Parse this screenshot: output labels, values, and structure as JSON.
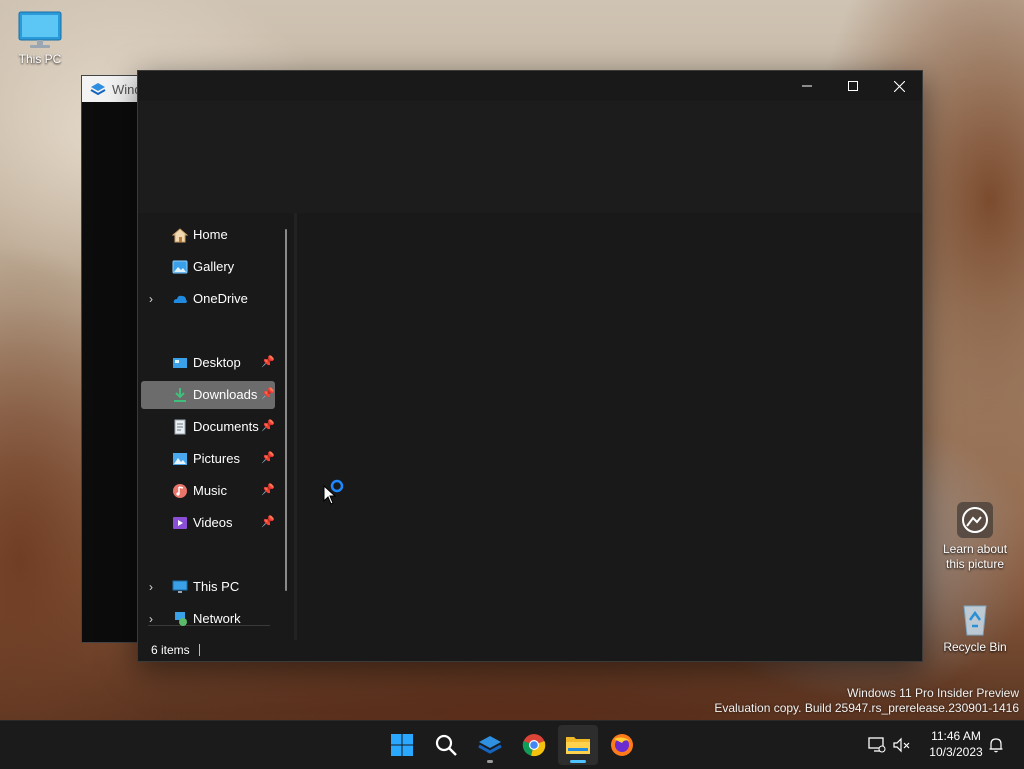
{
  "desktop": {
    "this_pc_label": "This PC",
    "learn_label_1": "Learn about",
    "learn_label_2": "this picture",
    "recycle_label": "Recycle Bin"
  },
  "background_window": {
    "title": "Wind"
  },
  "explorer": {
    "caption": {
      "minimize": "minimize-icon",
      "maximize": "maximize-icon",
      "close": "close-icon"
    },
    "nav": {
      "quick": [
        {
          "label": "Home",
          "icon": "home-icon"
        },
        {
          "label": "Gallery",
          "icon": "gallery-icon"
        },
        {
          "label": "OneDrive",
          "icon": "onedrive-icon",
          "expandable": true
        }
      ],
      "pinned": [
        {
          "label": "Desktop",
          "icon": "desktop-folder-icon"
        },
        {
          "label": "Downloads",
          "icon": "downloads-folder-icon",
          "selected": true
        },
        {
          "label": "Documents",
          "icon": "documents-folder-icon"
        },
        {
          "label": "Pictures",
          "icon": "pictures-folder-icon"
        },
        {
          "label": "Music",
          "icon": "music-folder-icon"
        },
        {
          "label": "Videos",
          "icon": "videos-folder-icon"
        }
      ],
      "devices": [
        {
          "label": "This PC",
          "icon": "this-pc-icon",
          "expandable": true
        },
        {
          "label": "Network",
          "icon": "network-icon",
          "expandable": true
        }
      ]
    },
    "status": {
      "items_count": "6 items"
    }
  },
  "taskbar": {
    "apps": [
      {
        "name": "start-button",
        "icon": "windows-logo-icon"
      },
      {
        "name": "search-button",
        "icon": "search-icon"
      },
      {
        "name": "app-button",
        "icon": "app-icon",
        "running": true
      },
      {
        "name": "chrome-button",
        "icon": "chrome-icon"
      },
      {
        "name": "file-explorer-button",
        "icon": "folder-icon",
        "active": true
      },
      {
        "name": "firefox-button",
        "icon": "firefox-icon"
      }
    ],
    "tray": {
      "time": "11:46 AM",
      "date": "10/3/2023"
    }
  },
  "watermark": {
    "line1": "Windows 11 Pro Insider Preview",
    "line2": "Evaluation copy. Build 25947.rs_prerelease.230901-1416"
  },
  "colors": {
    "accent": "#4cc2ff",
    "explorer_bg": "#191919",
    "selected_bg": "#6c6c6c",
    "taskbar_bg": "#1b1b1b"
  }
}
